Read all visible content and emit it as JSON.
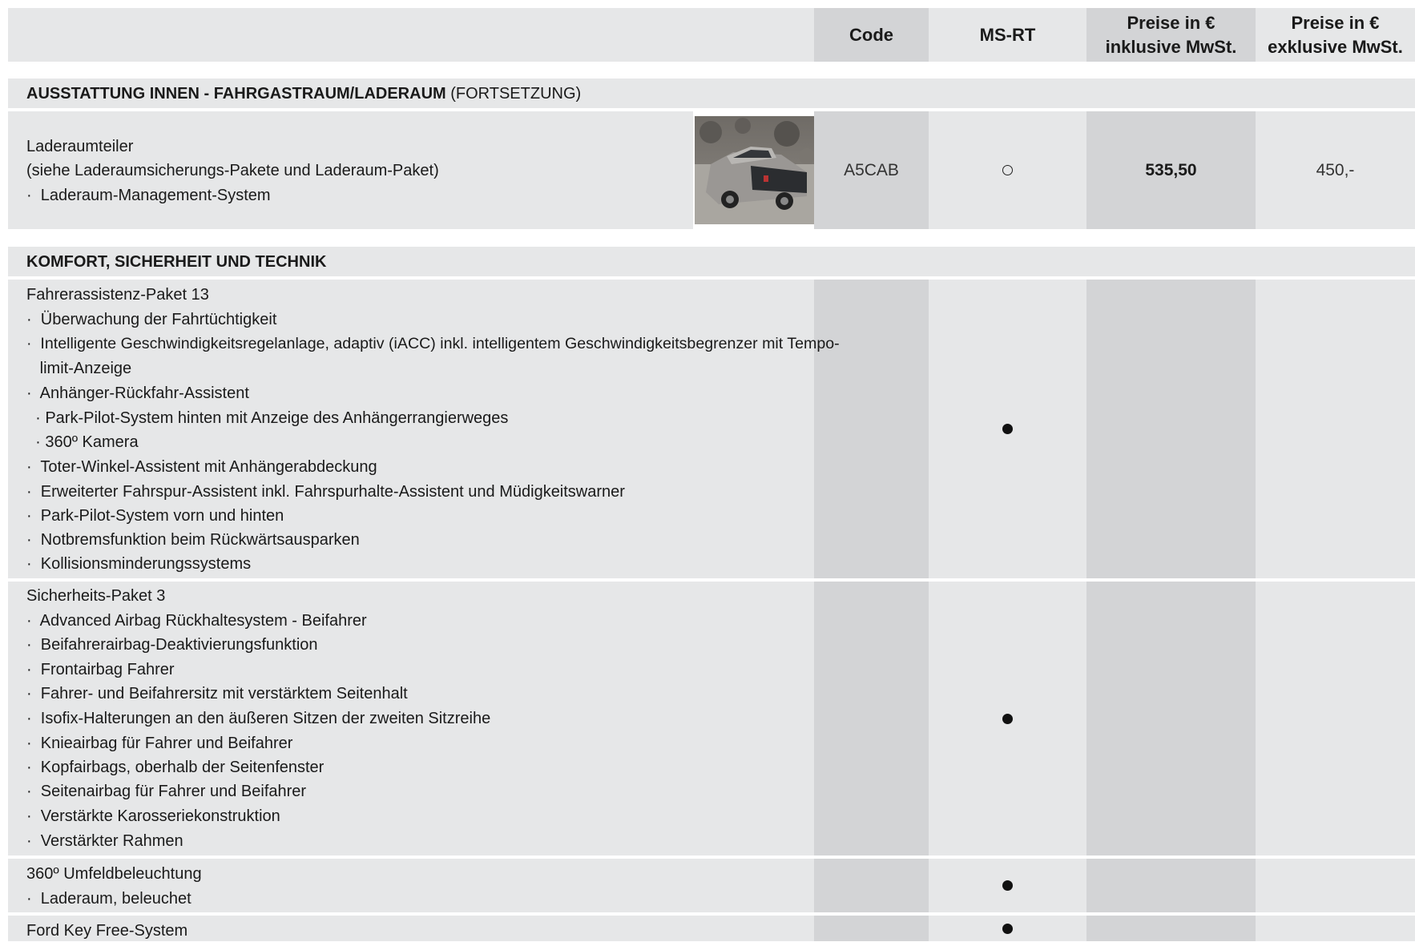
{
  "header": {
    "code": "Code",
    "msrt": "MS-RT",
    "price_incl": "Preise in € inklusive MwSt.",
    "price_excl": "Preise in € exklusive MwSt."
  },
  "section1": {
    "title_bold": "AUSSTATTUNG INNEN - FAHRGASTRAUM/LADERAUM",
    "title_suffix": " (FORTSETZUNG)"
  },
  "item_laderaumteiler": {
    "lines": [
      "Laderaumteiler",
      "(siehe Laderaumsicherungs-Pakete und Laderaum-Paket)",
      "·  Laderaum-Management-System"
    ],
    "code": "A5CAB",
    "msrt": "optional",
    "price_incl": "535,50",
    "price_excl": "450,-"
  },
  "section2": {
    "title_bold": "KOMFORT, SICHERHEIT UND TECHNIK"
  },
  "item_fahrerassistenz": {
    "lines": [
      "Fahrerassistenz-Paket 13",
      "·  Überwachung der Fahrtüchtigkeit",
      "·  Intelligente Geschwindigkeitsregelanlage, adaptiv (iACC) inkl. intelligentem Geschwindigkeitsbegrenzer mit Tempo-",
      "   limit-Anzeige",
      "·  Anhänger-Rückfahr-Assistent",
      "  · Park-Pilot-System hinten mit Anzeige des Anhängerrangierweges",
      "  · 360º Kamera",
      "·  Toter-Winkel-Assistent mit Anhängerabdeckung",
      "·  Erweiterter Fahrspur-Assistent inkl. Fahrspurhalte-Assistent und Müdigkeitswarner",
      "·  Park-Pilot-System vorn und hinten",
      "·  Notbremsfunktion beim Rückwärtsausparken",
      "·  Kollisionsminderungssystems"
    ],
    "msrt": "standard"
  },
  "item_sicherheit": {
    "lines": [
      "Sicherheits-Paket 3",
      "·  Advanced Airbag Rückhaltesystem - Beifahrer",
      "·  Beifahrerairbag-Deaktivierungsfunktion",
      "·  Frontairbag Fahrer",
      "·  Fahrer- und Beifahrersitz mit verstärktem Seitenhalt",
      "·  Isofix-Halterungen an den äußeren Sitzen der zweiten Sitzreihe",
      "·  Knieairbag für Fahrer und Beifahrer",
      "·  Kopfairbags, oberhalb der Seitenfenster",
      "·  Seitenairbag für Fahrer und Beifahrer",
      "·  Verstärkte Karosseriekonstruktion",
      "·  Verstärkter Rahmen"
    ],
    "msrt": "standard"
  },
  "item_umfeld": {
    "lines": [
      "360º Umfeldbeleuchtung",
      "·  Laderaum, beleuchet"
    ],
    "msrt": "standard"
  },
  "item_keyfree": {
    "lines": [
      "Ford Key Free-System"
    ],
    "msrt": "standard"
  },
  "icons": {
    "standard": "filled-circle-icon",
    "optional": "open-circle-icon"
  }
}
